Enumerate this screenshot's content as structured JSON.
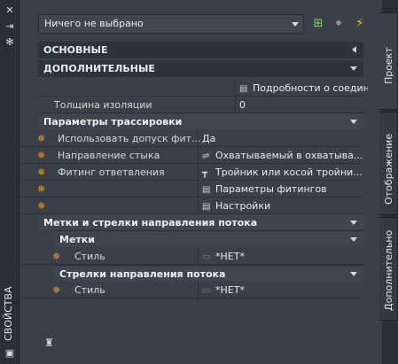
{
  "left_strip": {
    "close_glyph": "✕",
    "pin_glyph": "⇥",
    "settings_glyph": "✻",
    "title": "СВОЙСТВА",
    "corner_glyph": "▣"
  },
  "selector": {
    "value": "Ничего не выбрано"
  },
  "toolbar": {
    "add_glyph": "⊞",
    "pick_glyph": "⌖",
    "quick_select_glyph": "⚡"
  },
  "sections": {
    "basic": "ОСНОВНЫЕ",
    "additional": "ДОПОЛНИТЕЛЬНЫЕ"
  },
  "rows_top": [
    {
      "label": "",
      "value": "Подробности о соединениях",
      "icon": "table-icon"
    },
    {
      "label": "Толщина изоляции",
      "value": "0",
      "icon": ""
    }
  ],
  "routing": {
    "header": "Параметры трассировки",
    "rows": [
      {
        "label": "Использовать допуск фит...",
        "value": "Да",
        "icon": ""
      },
      {
        "label": "Направление стыка",
        "value": "Охватываемый в охватыва...",
        "icon": "joint-direction-icon"
      },
      {
        "label": "Фитинг ответвления",
        "value": "Тройник или косой тройни...",
        "icon": "tee-fitting-icon"
      },
      {
        "label": "",
        "value": "Параметры фитингов",
        "icon": "table-icon"
      },
      {
        "label": "",
        "value": "Настройки",
        "icon": "table-icon"
      }
    ]
  },
  "flow": {
    "header": "Метки и стрелки направления потока",
    "labels": {
      "header": "Метки",
      "style_label": "Стиль",
      "style_value": "*НЕТ*"
    },
    "arrows": {
      "header": "Стрелки направления потока",
      "style_label": "Стиль",
      "style_value": "*НЕТ*"
    }
  },
  "tabs": [
    "Проект",
    "Отображение",
    "Дополнительно"
  ],
  "colors": {
    "accent_star": "#f0a030",
    "panel": "#3b4048",
    "strip": "#2a2e35"
  }
}
